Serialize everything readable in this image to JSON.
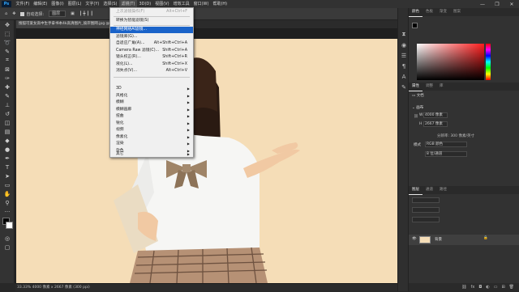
{
  "app": {
    "logo": "Ps"
  },
  "menubar": {
    "items": [
      "文件(F)",
      "编辑(E)",
      "图像(I)",
      "图层(L)",
      "文字(Y)",
      "选择(S)",
      "滤镜(T)",
      "3D(D)",
      "视图(V)",
      "增效工具",
      "窗口(W)",
      "帮助(H)"
    ],
    "active_index": 6,
    "window_controls": [
      "—",
      "❐",
      "✕"
    ]
  },
  "options": {
    "auto_select_label": "自动选择:",
    "auto_select_value": "图层"
  },
  "document": {
    "tab_title": "搜狐可爱女高中生手拿书本4k高清图片_彼岸图网.jpg @ 33.3%(RGB/8#)",
    "status": "33.33%   4000 像素 x 2667 像素 (300 ppi)"
  },
  "filter_menu": {
    "items": [
      {
        "label": "上次滤镜操作(F)",
        "shortcut": "Alt+Ctrl+F",
        "disabled": true
      },
      {
        "separator": true
      },
      {
        "label": "转换为智能滤镜(S)"
      },
      {
        "separator": true
      },
      {
        "label": "神经网络AI滤镜...",
        "highlight": true
      },
      {
        "label": "滤镜库(G)..."
      },
      {
        "label": "自适应广角(A)...",
        "shortcut": "Alt+Shift+Ctrl+A"
      },
      {
        "label": "Camera Raw 滤镜(C)...",
        "shortcut": "Shift+Ctrl+A"
      },
      {
        "label": "镜头校正(R)...",
        "shortcut": "Shift+Ctrl+R"
      },
      {
        "label": "液化(L)...",
        "shortcut": "Shift+Ctrl+X"
      },
      {
        "label": "消失点(V)...",
        "shortcut": "Alt+Ctrl+V"
      },
      {
        "separator": true
      },
      {
        "label": "3D",
        "submenu": true
      },
      {
        "label": "风格化",
        "submenu": true
      },
      {
        "label": "模糊",
        "submenu": true
      },
      {
        "label": "模糊画廊",
        "submenu": true
      },
      {
        "label": "扭曲",
        "submenu": true
      },
      {
        "label": "锐化",
        "submenu": true
      },
      {
        "label": "视频",
        "submenu": true
      },
      {
        "label": "像素化",
        "submenu": true
      },
      {
        "label": "渲染",
        "submenu": true
      },
      {
        "label": "杂色",
        "submenu": true
      },
      {
        "label": "其它",
        "submenu": true
      }
    ]
  },
  "panels": {
    "color_tabs": [
      "颜色",
      "色板",
      "渐变",
      "图案"
    ],
    "properties_tabs": [
      "属性",
      "调整",
      "库"
    ],
    "doc_label": "文档",
    "canvas_label": "画布",
    "width_label": "W",
    "width_value": "4000 像素",
    "height_label": "H",
    "height_value": "2667 像素",
    "resolution": "分辨率: 300 像素/英寸",
    "mode_label": "模式",
    "mode_value": "RGB 颜色",
    "bit_value": "8 位/通道",
    "layers_tabs": [
      "图层",
      "通道",
      "路径"
    ],
    "layer_name": "背景"
  },
  "colors": {
    "accent": "#1a63c9",
    "background": "#f5ddb7",
    "foreground": "#000000",
    "picker_hue": "#ff1d1d"
  }
}
